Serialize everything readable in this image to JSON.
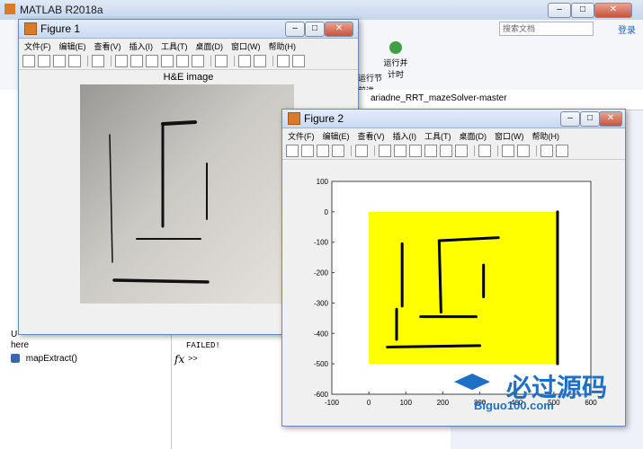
{
  "app": {
    "title": "MATLAB R2018a"
  },
  "ribbon": {
    "search_placeholder": "搜索文档",
    "login_label": "登录",
    "run_section_label": "运行节",
    "advance_label": "前进",
    "run_and_time_label": "运行并\n计时"
  },
  "address": {
    "current_folder": "ariadne_RRT_mazeSolver-master"
  },
  "workspace": {
    "text_a": "U",
    "text_b": "here",
    "file_item": "mapExtract()"
  },
  "command": {
    "output": "FAILED!",
    "prompt": ">>",
    "fx_label": "fx"
  },
  "menu": [
    "文件(F)",
    "编辑(E)",
    "查看(V)",
    "插入(I)",
    "工具(T)",
    "桌面(D)",
    "窗口(W)",
    "帮助(H)"
  ],
  "figure1": {
    "title": "Figure 1",
    "image_title": "H&E image"
  },
  "figure2": {
    "title": "Figure 2",
    "chart_data": {
      "type": "scatter",
      "title": "",
      "xlabel": "",
      "ylabel": "",
      "xlim": [
        -100,
        600
      ],
      "ylim": [
        -600,
        100
      ],
      "y_reversed": true,
      "xticks": [
        -100,
        0,
        100,
        200,
        300,
        400,
        500,
        600
      ],
      "yticks": [
        100,
        0,
        -100,
        -200,
        -300,
        -400,
        -500,
        -600
      ],
      "xtick_labels": [
        "-100",
        "0",
        "100",
        "200",
        "300",
        "400",
        "500",
        "600"
      ],
      "ytick_labels": [
        "100",
        "0",
        "-100",
        "-200",
        "-300",
        "-400",
        "-500",
        "-600"
      ],
      "fill_region": {
        "x": [
          0,
          510
        ],
        "y": [
          0,
          -500
        ],
        "color": "#ffff00"
      },
      "maze_walls": [
        {
          "x": [
            190,
            350
          ],
          "y": [
            -95,
            -85
          ]
        },
        {
          "x": [
            190,
            195
          ],
          "y": [
            -95,
            -330
          ]
        },
        {
          "x": [
            310,
            310
          ],
          "y": [
            -175,
            -280
          ]
        },
        {
          "x": [
            140,
            290
          ],
          "y": [
            -345,
            -345
          ]
        },
        {
          "x": [
            90,
            90
          ],
          "y": [
            -105,
            -310
          ]
        },
        {
          "x": [
            50,
            300
          ],
          "y": [
            -445,
            -440
          ]
        },
        {
          "x": [
            510,
            510
          ],
          "y": [
            0,
            -500
          ]
        },
        {
          "x": [
            75,
            75
          ],
          "y": [
            -320,
            -420
          ]
        }
      ],
      "wall_color": "#000000"
    }
  },
  "watermark": {
    "text": "必过源码",
    "url": "Biguo100.com"
  }
}
